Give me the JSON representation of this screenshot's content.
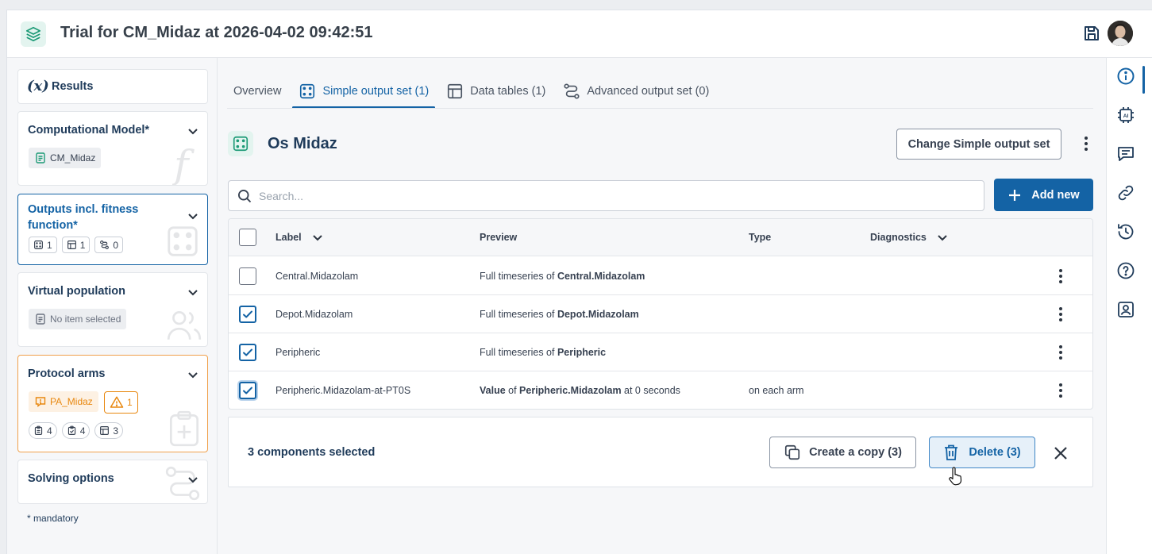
{
  "header": {
    "title": "Trial for CM_Midaz at 2026-04-02 09:42:51"
  },
  "sidebar": {
    "results_label": "Results",
    "computational_model": {
      "title": "Computational Model*",
      "chip": "CM_Midaz"
    },
    "outputs": {
      "title_line1": "Outputs incl. fitness",
      "title_line2": "function*",
      "counts": [
        "1",
        "1",
        "0"
      ]
    },
    "virtual_population": {
      "title": "Virtual population",
      "chip": "No item selected"
    },
    "protocol_arms": {
      "title": "Protocol arms",
      "chip": "PA_Midaz",
      "warning_count": "1",
      "counts": [
        "4",
        "4",
        "3"
      ]
    },
    "solving_options": {
      "title": "Solving options"
    },
    "mandatory_note": "* mandatory"
  },
  "tabs": [
    {
      "label": "Overview"
    },
    {
      "label": "Simple output set (1)"
    },
    {
      "label": "Data tables (1)"
    },
    {
      "label": "Advanced output set (0)"
    }
  ],
  "section": {
    "title": "Os Midaz",
    "change_button": "Change Simple output set"
  },
  "search": {
    "placeholder": "Search..."
  },
  "add_button": "Add new",
  "table": {
    "headers": {
      "label": "Label",
      "preview": "Preview",
      "type": "Type",
      "diagnostics": "Diagnostics"
    },
    "rows": [
      {
        "label": "Central.Midazolam",
        "pre1": "Full timeseries of ",
        "bold1": "Central.Midazolam",
        "mid": "",
        "bold2": "",
        "post": "",
        "type": "",
        "checked": false
      },
      {
        "label": "Depot.Midazolam",
        "pre1": "Full timeseries of ",
        "bold1": "Depot.Midazolam",
        "mid": "",
        "bold2": "",
        "post": "",
        "type": "",
        "checked": true
      },
      {
        "label": "Peripheric",
        "pre1": "Full timeseries of ",
        "bold1": "Peripheric",
        "mid": "",
        "bold2": "",
        "post": "",
        "type": "",
        "checked": true
      },
      {
        "label": "Peripheric.Midazolam-at-PT0S",
        "pre1": "",
        "bold1": "Value",
        "mid": " of ",
        "bold2": "Peripheric.Midazolam",
        "post": " at 0 seconds",
        "type": "on each arm",
        "checked": true
      }
    ]
  },
  "selection": {
    "count_text": "3 components selected",
    "copy_button": "Create a copy (3)",
    "delete_button": "Delete (3)"
  },
  "colors": {
    "accent": "#1463a5",
    "brand_green": "#1c9a76",
    "warning": "#e8870e"
  },
  "icons": {
    "rail": [
      "info-icon",
      "ai-chip-icon",
      "comment-icon",
      "link-icon",
      "history-icon",
      "help-icon",
      "contact-card-icon"
    ]
  }
}
